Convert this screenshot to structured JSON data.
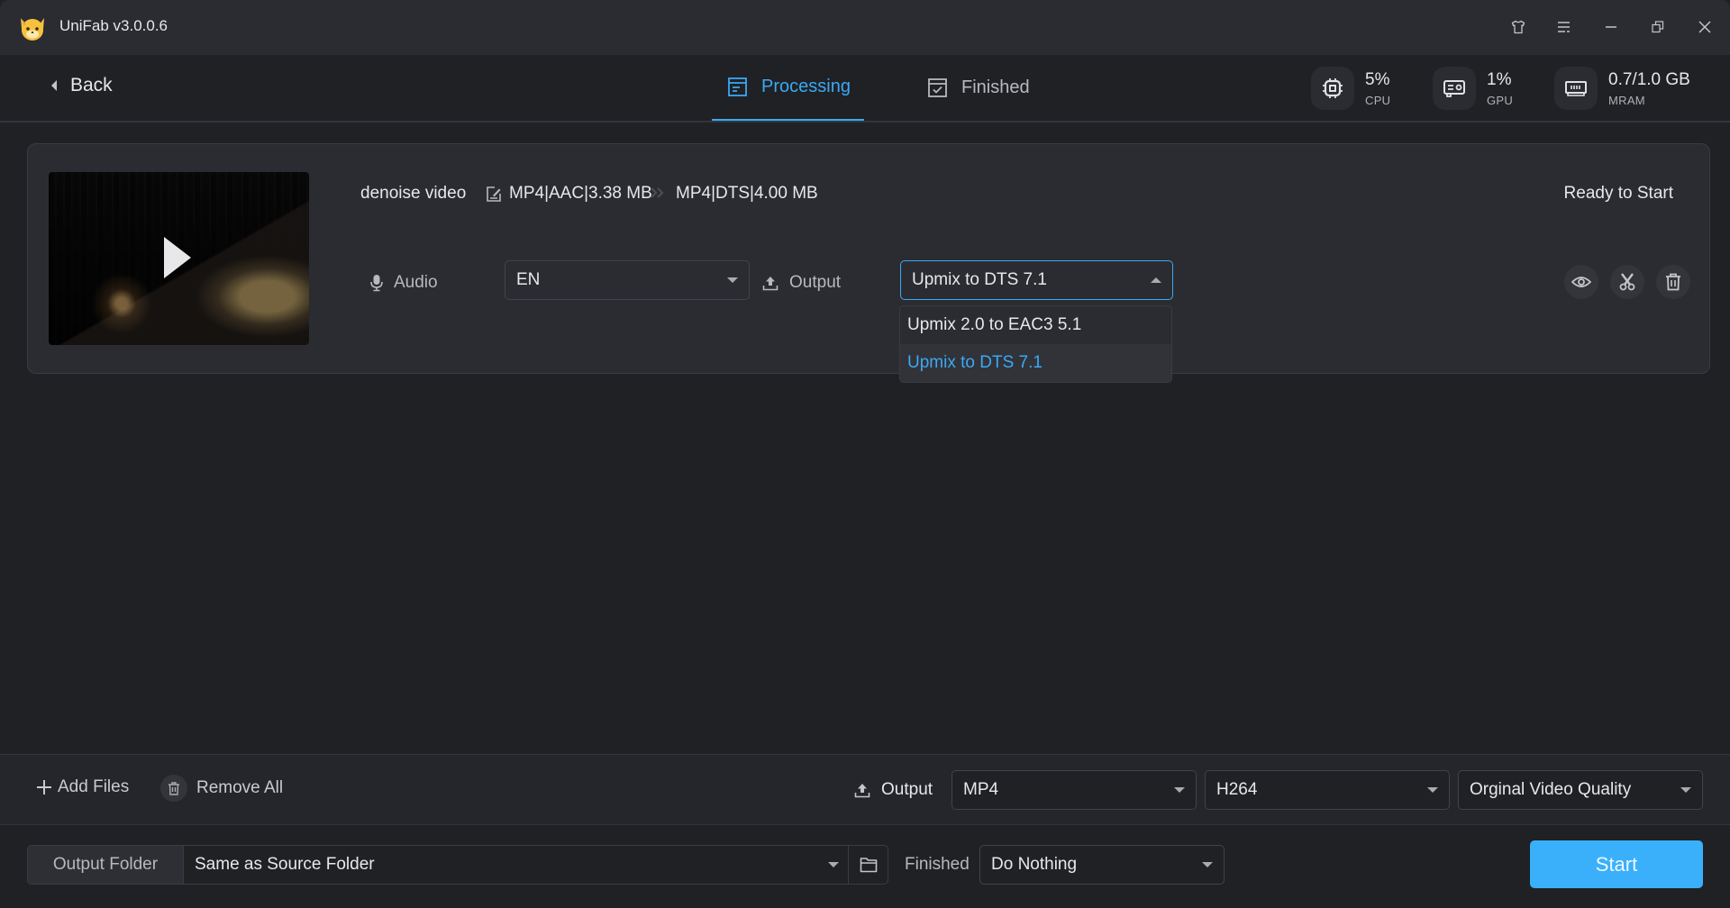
{
  "window": {
    "title": "UniFab v3.0.0.6",
    "controls": [
      "skin-icon",
      "menu-icon",
      "minimize-icon",
      "restore-icon",
      "close-icon"
    ]
  },
  "header": {
    "back_label": "Back",
    "tabs": [
      {
        "label": "Processing",
        "icon": "list-icon",
        "active": true
      },
      {
        "label": "Finished",
        "icon": "checkbox-icon",
        "active": false
      }
    ],
    "stats": [
      {
        "value": "5%",
        "label": "CPU",
        "icon": "cpu-icon"
      },
      {
        "value": "1%",
        "label": "GPU",
        "icon": "gpu-icon"
      },
      {
        "value": "0.7/1.0 GB",
        "label": "MRAM",
        "icon": "ram-icon"
      }
    ]
  },
  "task": {
    "file_name": "denoise video",
    "source_info": "MP4|AAC|3.38 MB",
    "target_info": "MP4|DTS|4.00 MB",
    "status": "Ready to Start",
    "audio_label": "Audio",
    "audio_value": "EN",
    "output_label": "Output",
    "output_value": "Upmix to DTS 7.1",
    "output_options": [
      {
        "label": "Upmix 2.0 to EAC3 5.1",
        "selected": false
      },
      {
        "label": "Upmix to DTS 7.1",
        "selected": true
      }
    ],
    "actions": [
      "preview",
      "trim",
      "delete"
    ]
  },
  "bottom": {
    "add_files_label": "Add Files",
    "remove_all_label": "Remove All",
    "output_label": "Output",
    "format_value": "MP4",
    "codec_value": "H264",
    "quality_value": "Orginal Video Quality",
    "output_folder_label": "Output Folder",
    "output_folder_value": "Same as Source Folder",
    "finished_label": "Finished",
    "finished_value": "Do Nothing",
    "start_label": "Start"
  },
  "colors": {
    "accent": "#3aa9f4",
    "start_button": "#3ab0fb",
    "background": "#202125",
    "panel": "#2b2c31"
  }
}
